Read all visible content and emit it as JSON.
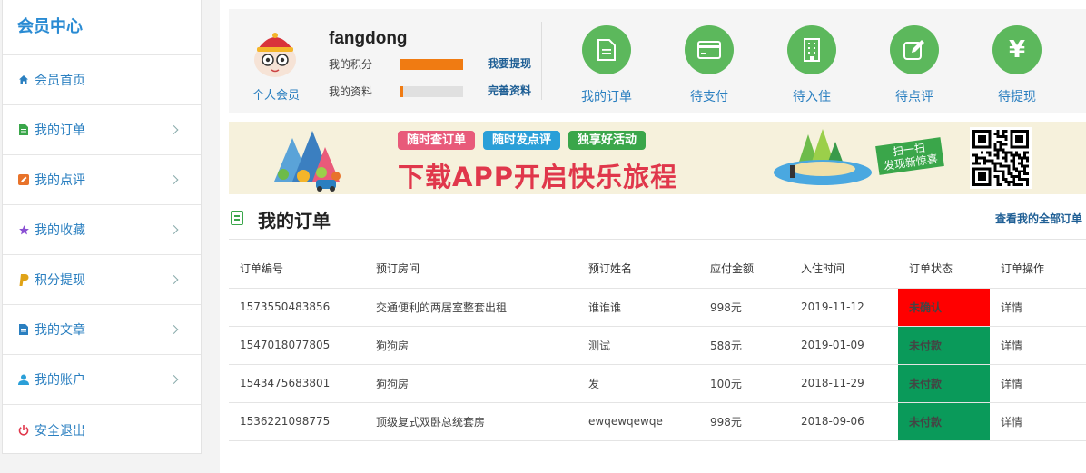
{
  "sidebar": {
    "title": "会员中心",
    "items": [
      {
        "label": "会员首页",
        "icon": "home-icon",
        "color": "#2a7fc0"
      },
      {
        "label": "我的订单",
        "icon": "document-icon",
        "color": "#3aa64a"
      },
      {
        "label": "我的点评",
        "icon": "edit-icon",
        "color": "#e8732a"
      },
      {
        "label": "我的收藏",
        "icon": "star-icon",
        "color": "#8a4fd3"
      },
      {
        "label": "积分提现",
        "icon": "paypal-icon",
        "color": "#e0a317"
      },
      {
        "label": "我的文章",
        "icon": "file-icon",
        "color": "#2a7fc0"
      },
      {
        "label": "我的账户",
        "icon": "user-icon",
        "color": "#2a9fd8"
      },
      {
        "label": "安全退出",
        "icon": "power-icon",
        "color": "#e0374b"
      }
    ]
  },
  "profile": {
    "username": "fangdong",
    "role": "个人会员",
    "points_label": "我的积分",
    "points_progress": 1.0,
    "withdraw_link": "我要提现",
    "info_label": "我的资料",
    "info_progress": 0.06,
    "complete_link": "完善资料"
  },
  "quick_actions": [
    {
      "label": "我的订单",
      "icon": "document-icon"
    },
    {
      "label": "待支付",
      "icon": "card-icon"
    },
    {
      "label": "待入住",
      "icon": "building-icon"
    },
    {
      "label": "待点评",
      "icon": "edit-icon"
    },
    {
      "label": "待提现",
      "icon": "yen-icon"
    }
  ],
  "banner": {
    "tags": [
      {
        "label": "随时查订单",
        "color": "#e85a7a"
      },
      {
        "label": "随时发点评",
        "color": "#2a9fd8"
      },
      {
        "label": "独享好活动",
        "color": "#3aa64a"
      }
    ],
    "title": "下载APP开启快乐旅程",
    "scan_text_1": "扫一扫",
    "scan_text_2": "发现新惊喜"
  },
  "orders": {
    "title": "我的订单",
    "view_all": "查看我的全部订单",
    "columns": [
      "订单编号",
      "预订房间",
      "预订姓名",
      "应付金额",
      "入住时间",
      "订单状态",
      "订单操作"
    ],
    "rows": [
      {
        "id": "1573550483856",
        "room": "交通便利的两居室整套出租",
        "name": "谁谁谁",
        "amount": "998元",
        "date": "2019-11-12",
        "status": "未确认",
        "status_color": "#ff0000",
        "action": "详情"
      },
      {
        "id": "1547018077805",
        "room": "狗狗房",
        "name": "测试",
        "amount": "588元",
        "date": "2019-01-09",
        "status": "未付款",
        "status_color": "#0a9a5a",
        "action": "详情"
      },
      {
        "id": "1543475683801",
        "room": "狗狗房",
        "name": "发",
        "amount": "100元",
        "date": "2018-11-29",
        "status": "未付款",
        "status_color": "#0a9a5a",
        "action": "详情"
      },
      {
        "id": "1536221098775",
        "room": "顶级复式双卧总统套房",
        "name": "ewqewqewqe",
        "amount": "998元",
        "date": "2018-09-06",
        "status": "未付款",
        "status_color": "#0a9a5a",
        "action": "详情"
      }
    ]
  }
}
